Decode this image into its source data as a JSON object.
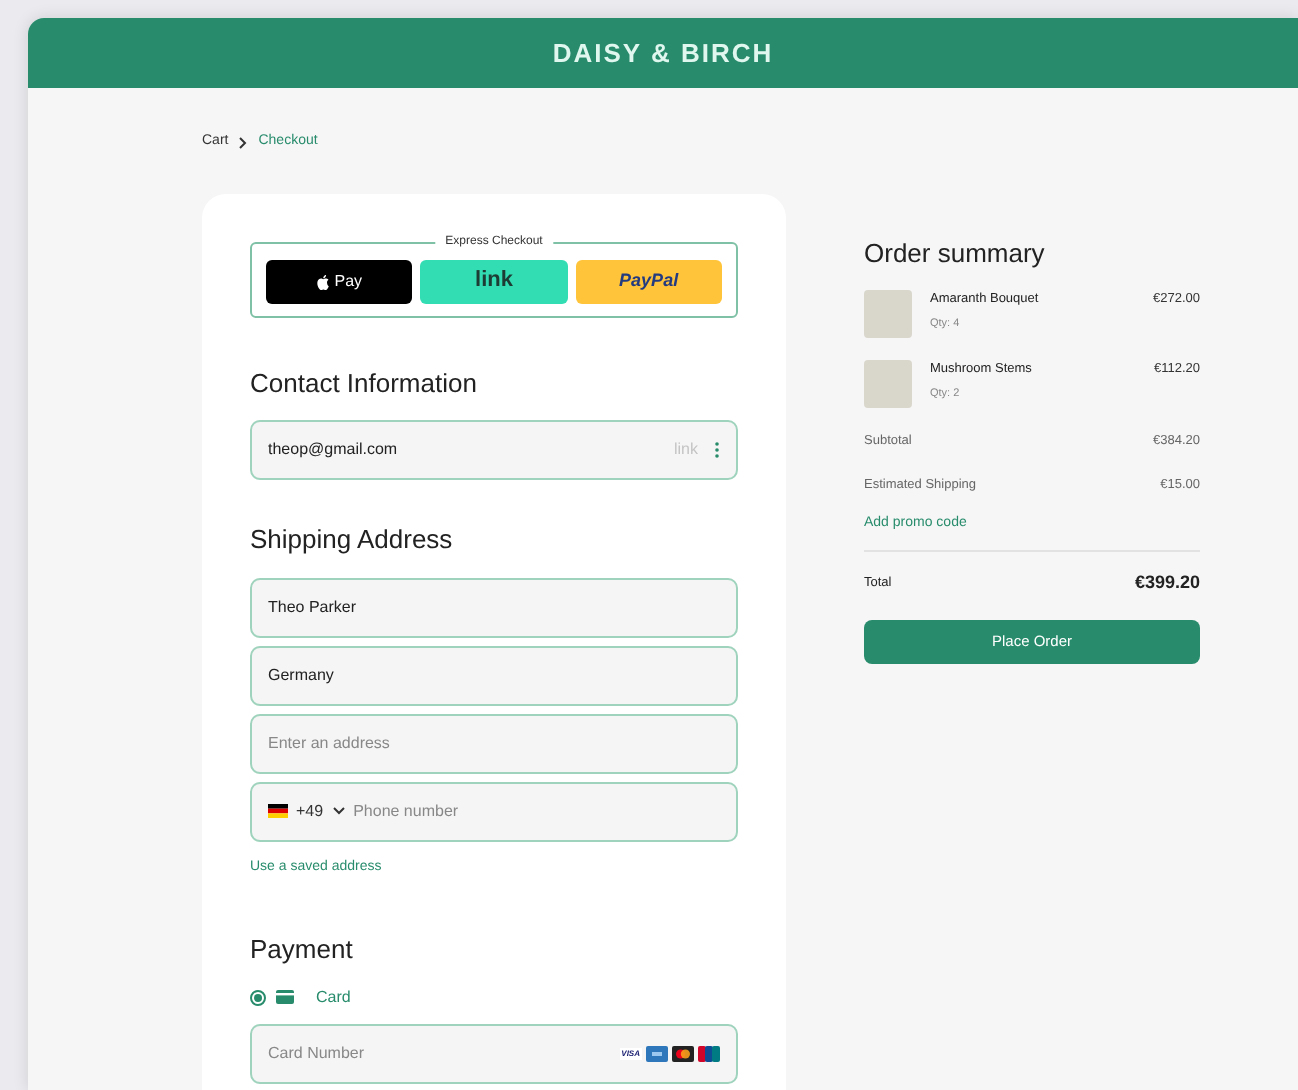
{
  "header": {
    "brand": "DAISY & BIRCH"
  },
  "breadcrumb": [
    {
      "label": "Cart",
      "selected": false
    },
    {
      "label": "Checkout",
      "selected": true
    }
  ],
  "express_checkout": {
    "legend": "Express Checkout",
    "buttons": [
      {
        "kind": "apple",
        "label": "Pay"
      },
      {
        "kind": "link",
        "label": "link"
      },
      {
        "kind": "paypal",
        "label": "PayPal"
      }
    ]
  },
  "contact": {
    "heading": "Contact Information",
    "email": {
      "value": "theop@gmail.com",
      "badge": "link"
    }
  },
  "shipping": {
    "heading": "Shipping Address",
    "fields": [
      {
        "kind": "text",
        "value": "Theo Parker"
      },
      {
        "kind": "text",
        "value": "Germany"
      },
      {
        "kind": "text",
        "placeholder": "Enter an address"
      },
      {
        "kind": "phone",
        "code": "+49",
        "placeholder": "Phone number"
      }
    ],
    "saved_link": "Use a saved address"
  },
  "payment": {
    "heading": "Payment",
    "methods": [
      {
        "label": "Card",
        "selected": true
      }
    ],
    "card_number": {
      "placeholder": "Card Number",
      "brands": [
        "VISA"
      ]
    }
  },
  "summary": {
    "heading": "Order summary",
    "items": [
      {
        "name": "Amaranth Bouquet",
        "qty": "Qty: 4",
        "price": "€272.00"
      },
      {
        "name": "Mushroom Stems",
        "qty": "Qty: 2",
        "price": "€112.20"
      }
    ],
    "lines": [
      {
        "label": "Subtotal",
        "value": "€384.20"
      },
      {
        "label": "Estimated Shipping",
        "value": "€15.00"
      }
    ],
    "promo": "Add promo code",
    "total_label": "Total",
    "total": "€399.20",
    "button": "Place Order"
  }
}
